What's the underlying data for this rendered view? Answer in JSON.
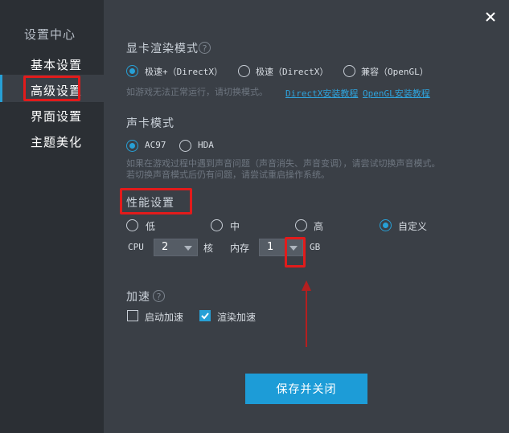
{
  "sidebar": {
    "title": "设置中心",
    "items": [
      {
        "label": "基本设置"
      },
      {
        "label": "高级设置"
      },
      {
        "label": "界面设置"
      },
      {
        "label": "主题美化"
      }
    ]
  },
  "display": {
    "title": "显卡渲染模式",
    "options": [
      "极速+（DirectX）",
      "极速（DirectX）",
      "兼容（OpenGL）"
    ],
    "hint": "如游戏无法正常运行，请切换模式。",
    "link_directx": "DirectX安装教程",
    "link_opengl": "OpenGL安装教程"
  },
  "sound": {
    "title": "声卡模式",
    "options": [
      "AC97",
      "HDA"
    ],
    "hint_line1": "如果在游戏过程中遇到声音问题（声音消失、声音变调），请尝试切换声音模式。",
    "hint_line2": "若切换声音模式后仍有问题，请尝试重启操作系统。"
  },
  "performance": {
    "title": "性能设置",
    "options": [
      "低",
      "中",
      "高",
      "自定义"
    ],
    "cpu_label": "CPU",
    "cpu_value": "2",
    "cpu_unit": "核",
    "mem_label": "内存",
    "mem_value": "1",
    "mem_unit": "GB"
  },
  "accel": {
    "title": "加速",
    "options": [
      "启动加速",
      "渲染加速"
    ]
  },
  "save_label": "保存并关闭",
  "colors": {
    "accent": "#1d9cd7",
    "annotation": "#e21b1b"
  }
}
